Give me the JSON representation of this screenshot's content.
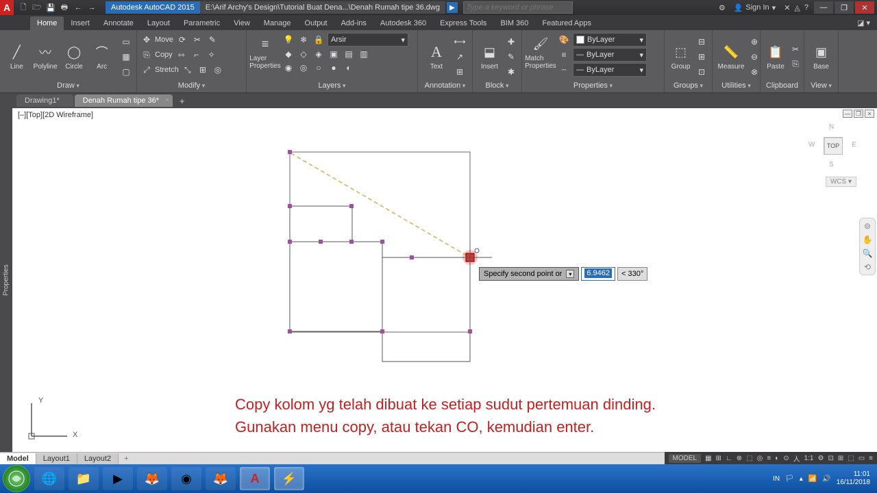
{
  "title": {
    "logo": "A",
    "appname": "Autodesk AutoCAD 2015",
    "filepath": "E:\\Arif Archy's Design\\Tutorial Buat Dena...\\Denah Rumah tipe 36.dwg",
    "search_placeholder": "Type a keyword or phrase",
    "signin": "Sign In"
  },
  "qat": [
    "🗋",
    "🗁",
    "💾",
    "🖶",
    "←",
    "→"
  ],
  "tabs": [
    "Home",
    "Insert",
    "Annotate",
    "Layout",
    "Parametric",
    "View",
    "Manage",
    "Output",
    "Add-ins",
    "Autodesk 360",
    "Express Tools",
    "BIM 360",
    "Featured Apps"
  ],
  "ribbon": {
    "draw": {
      "label": "Draw",
      "items": [
        "Line",
        "Polyline",
        "Circle",
        "Arc"
      ]
    },
    "modify": {
      "label": "Modify",
      "move": "Move",
      "copy": "Copy",
      "stretch": "Stretch"
    },
    "layers": {
      "label": "Layers",
      "lp": "Layer\nProperties",
      "current": "Arsir"
    },
    "annotation": {
      "label": "Annotation",
      "text": "Text"
    },
    "block": {
      "label": "Block",
      "insert": "Insert"
    },
    "properties": {
      "label": "Properties",
      "match": "Match\nProperties",
      "bylayer": "ByLayer"
    },
    "groups": {
      "label": "Groups",
      "group": "Group"
    },
    "utilities": {
      "label": "Utilities",
      "measure": "Measure"
    },
    "clipboard": {
      "label": "Clipboard",
      "paste": "Paste"
    },
    "view": {
      "label": "View",
      "base": "Base"
    }
  },
  "files": {
    "tab1": "Drawing1*",
    "tab2": "Denah Rumah tipe 36*"
  },
  "viewport": {
    "label": "[–][Top][2D Wireframe]",
    "prop": "Properties",
    "cube": "TOP",
    "wcs": "WCS ▾"
  },
  "dyninput": {
    "prompt": "Specify second point or",
    "val": "6.9462",
    "ang": "< 330°"
  },
  "instruction": {
    "l1": "Copy kolom yg telah dibuat ke setiap sudut pertemuan dinding.",
    "l2": "Gunakan menu copy, atau tekan CO, kemudian enter."
  },
  "ucs": {
    "y": "Y",
    "x": "X"
  },
  "layouts": {
    "model": "Model",
    "l1": "Layout1",
    "l2": "Layout2"
  },
  "status": {
    "model": "MODEL",
    "scale": "1:1"
  },
  "tray": {
    "lang": "IN",
    "time": "11:01",
    "date": "16/11/2018"
  }
}
